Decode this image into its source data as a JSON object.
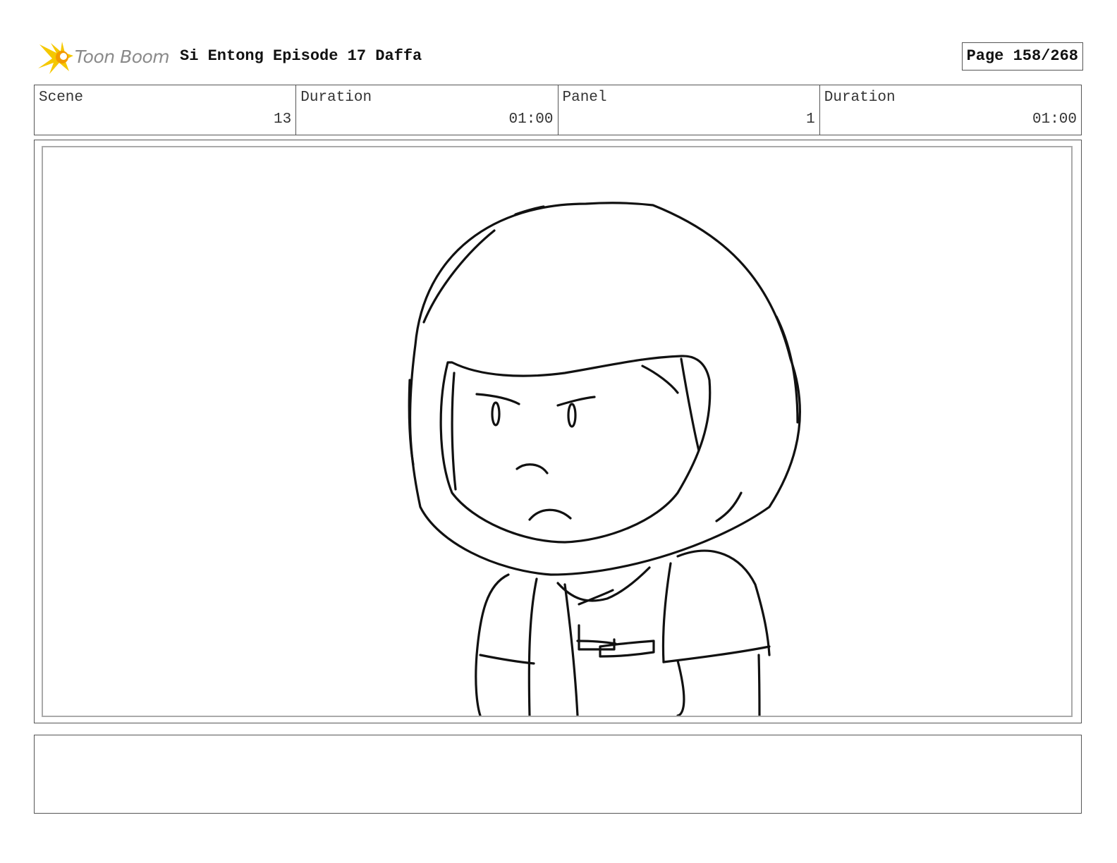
{
  "header": {
    "logo_text": "Toon Boom",
    "title": "Si Entong Episode 17 Daffa",
    "page": "Page 158/268"
  },
  "info": [
    {
      "label": "Scene",
      "value": "13"
    },
    {
      "label": "Duration",
      "value": "01:00"
    },
    {
      "label": "Panel",
      "value": "1"
    },
    {
      "label": "Duration",
      "value": "01:00"
    }
  ],
  "icons": {
    "logo": "starburst-logo-icon",
    "panel": "sketch-drawing"
  },
  "colors": {
    "logo_yellow": "#f5c800",
    "logo_orange": "#f39a00",
    "logo_text": "#8a8a8a",
    "border": "#555555",
    "inner_border": "#aaaaaa"
  },
  "notes": ""
}
